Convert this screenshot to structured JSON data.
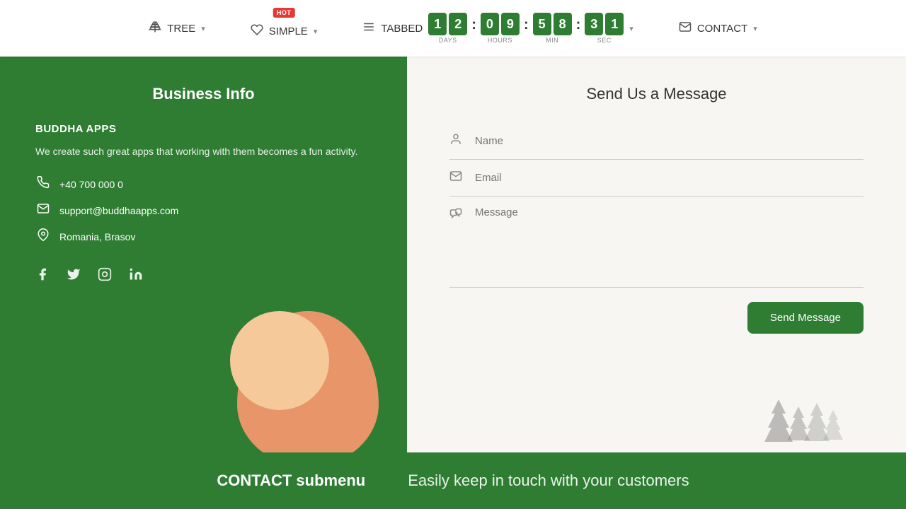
{
  "nav": {
    "items": [
      {
        "id": "tree",
        "label": "TREE",
        "icon": "⊞",
        "hasDropdown": true,
        "hasBadge": false
      },
      {
        "id": "simple",
        "label": "SIMPLE",
        "icon": "♡",
        "hasDropdown": true,
        "hasBadge": true,
        "badge": "HOT"
      },
      {
        "id": "tabbed",
        "label": "TABBED",
        "icon": "☰",
        "hasDropdown": false,
        "hasBadge": false
      },
      {
        "id": "contact",
        "label": "CONTACT",
        "icon": "✉",
        "hasDropdown": true,
        "hasBadge": false
      }
    ]
  },
  "countdown": {
    "days": [
      "1",
      "2"
    ],
    "hours": [
      "0",
      "9"
    ],
    "minutes": [
      "5",
      "8"
    ],
    "seconds": [
      "3",
      "1"
    ],
    "labels": [
      "DAYS",
      "HOURS",
      "MIN",
      "SEC"
    ]
  },
  "left": {
    "title": "Business Info",
    "company_name": "BUDDHA APPS",
    "description": "We create such great apps that working with them becomes a fun activity.",
    "phone": "+40 700 000 0",
    "email": "support@buddhaapps.com",
    "location": "Romania, Brasov"
  },
  "form": {
    "title": "Send Us a Message",
    "name_placeholder": "Name",
    "email_placeholder": "Email",
    "message_placeholder": "Message",
    "send_button": "Send Message"
  },
  "footer": {
    "submenu_label": "CONTACT submenu",
    "submenu_desc": "Easily keep in touch with your customers"
  }
}
